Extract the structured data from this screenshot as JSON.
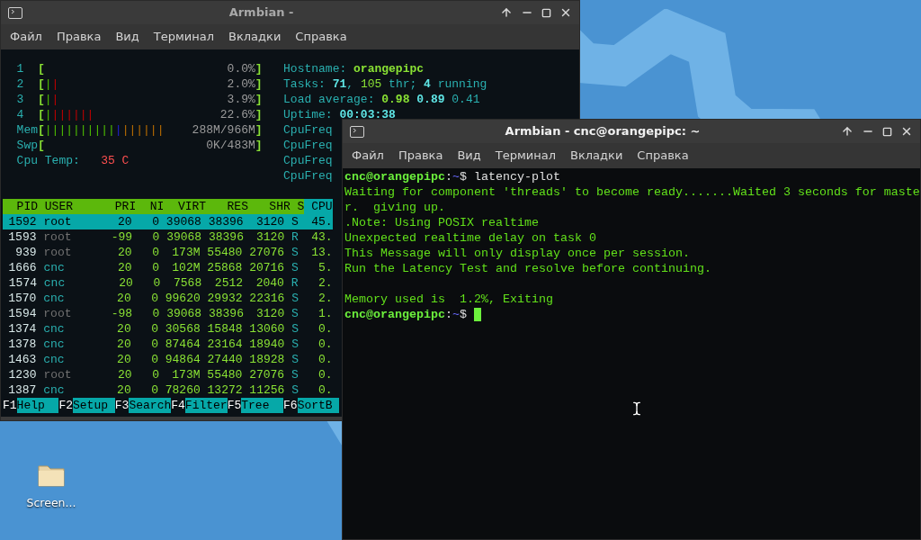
{
  "desktop": {
    "icons": [
      {
        "label": "Screen..."
      }
    ]
  },
  "windows": [
    {
      "kind": "htop",
      "title": "Armbian -",
      "active": false,
      "menu": [
        "Файл",
        "Правка",
        "Вид",
        "Терминал",
        "Вкладки",
        "Справка"
      ],
      "htop": {
        "meters": [
          {
            "label": "1",
            "brackets": [
              "[",
              "]"
            ],
            "value": "0.0%"
          },
          {
            "label": "2",
            "brackets": [
              "[",
              "]"
            ],
            "bars": [
              {
                "kind": "normal",
                "text": "|"
              },
              {
                "kind": "kernel",
                "text": "|"
              }
            ],
            "value": "2.0%"
          },
          {
            "label": "3",
            "brackets": [
              "[",
              "]"
            ],
            "bars": [
              {
                "kind": "normal",
                "text": "|"
              },
              {
                "kind": "kernel",
                "text": "|"
              }
            ],
            "value": "3.9%"
          },
          {
            "label": "4",
            "brackets": [
              "[",
              "]"
            ],
            "bars": [
              {
                "kind": "normal",
                "text": "|"
              },
              {
                "kind": "kernel",
                "text": "||||||"
              }
            ],
            "value": "22.6%"
          },
          {
            "label": "Mem",
            "brackets": [
              "[",
              "]"
            ],
            "bars": [
              {
                "kind": "normal",
                "text": "||||||||||"
              },
              {
                "kind": "buffers",
                "text": "|"
              },
              {
                "kind": "cache",
                "text": "||||||"
              }
            ],
            "value": "288M/966M"
          },
          {
            "label": "Swp",
            "brackets": [
              "[",
              "]"
            ],
            "value": "0K/483M"
          }
        ],
        "temp": {
          "label": "Cpu Temp:",
          "value": "35 C"
        },
        "info": [
          [
            {
              "kind": "label",
              "text": "Hostname: "
            },
            {
              "kind": "strong",
              "text": "orangepipc"
            }
          ],
          [
            {
              "kind": "label",
              "text": "Tasks: "
            },
            {
              "kind": "accent",
              "text": "71"
            },
            {
              "kind": "label",
              "text": ", "
            },
            {
              "kind": "green",
              "text": "105"
            },
            {
              "kind": "label",
              "text": " thr; "
            },
            {
              "kind": "accent",
              "text": "4"
            },
            {
              "kind": "label",
              "text": " running"
            }
          ],
          [
            {
              "kind": "label",
              "text": "Load average: "
            },
            {
              "kind": "strong",
              "text": "0.98"
            },
            {
              "kind": "accent",
              "text": " 0.89"
            },
            {
              "kind": "label",
              "text": " 0.41"
            }
          ],
          [
            {
              "kind": "label",
              "text": "Uptime: "
            },
            {
              "kind": "accent",
              "text": "00:03:38"
            }
          ],
          [
            {
              "kind": "label",
              "text": "CpuFreq"
            }
          ],
          [
            {
              "kind": "label",
              "text": "CpuFreq"
            }
          ],
          [
            {
              "kind": "label",
              "text": "CpuFreq"
            }
          ],
          [
            {
              "kind": "label",
              "text": "CpuFreq"
            }
          ]
        ],
        "columns": [
          {
            "label": "PID",
            "sorted": false
          },
          {
            "label": "USER",
            "sorted": false
          },
          {
            "label": "PRI",
            "sorted": false
          },
          {
            "label": "NI",
            "sorted": false
          },
          {
            "label": "VIRT",
            "sorted": false
          },
          {
            "label": "RES",
            "sorted": false
          },
          {
            "label": "SHR",
            "sorted": false
          },
          {
            "label": "S",
            "sorted": false
          },
          {
            "label": "CPU",
            "sorted": true
          }
        ],
        "rows": [
          {
            "selected": true,
            "user_dim": false,
            "cells": [
              "1592",
              "root",
              "20",
              "0",
              "39068",
              "38396",
              "3120",
              "S",
              "45."
            ]
          },
          {
            "selected": false,
            "user_dim": true,
            "cells": [
              "1593",
              "root",
              "-99",
              "0",
              "39068",
              "38396",
              "3120",
              "R",
              "43."
            ]
          },
          {
            "selected": false,
            "user_dim": true,
            "cells": [
              "939",
              "root",
              "20",
              "0",
              "173M",
              "55480",
              "27076",
              "S",
              "13."
            ]
          },
          {
            "selected": false,
            "user_dim": false,
            "cells": [
              "1666",
              "cnc",
              "20",
              "0",
              "102M",
              "25868",
              "20716",
              "S",
              "5."
            ]
          },
          {
            "selected": false,
            "user_dim": false,
            "cells": [
              "1574",
              "cnc",
              "20",
              "0",
              "7568",
              "2512",
              "2040",
              "R",
              "2."
            ]
          },
          {
            "selected": false,
            "user_dim": false,
            "cells": [
              "1570",
              "cnc",
              "20",
              "0",
              "99620",
              "29932",
              "22316",
              "S",
              "2."
            ]
          },
          {
            "selected": false,
            "user_dim": true,
            "cells": [
              "1594",
              "root",
              "-98",
              "0",
              "39068",
              "38396",
              "3120",
              "S",
              "1."
            ]
          },
          {
            "selected": false,
            "user_dim": false,
            "cells": [
              "1374",
              "cnc",
              "20",
              "0",
              "30568",
              "15848",
              "13060",
              "S",
              "0."
            ]
          },
          {
            "selected": false,
            "user_dim": false,
            "cells": [
              "1378",
              "cnc",
              "20",
              "0",
              "87464",
              "23164",
              "18940",
              "S",
              "0."
            ]
          },
          {
            "selected": false,
            "user_dim": false,
            "cells": [
              "1463",
              "cnc",
              "20",
              "0",
              "94864",
              "27440",
              "18928",
              "S",
              "0."
            ]
          },
          {
            "selected": false,
            "user_dim": true,
            "cells": [
              "1230",
              "root",
              "20",
              "0",
              "173M",
              "55480",
              "27076",
              "S",
              "0."
            ]
          },
          {
            "selected": false,
            "user_dim": false,
            "cells": [
              "1387",
              "cnc",
              "20",
              "0",
              "78260",
              "13272",
              "11256",
              "S",
              "0."
            ]
          }
        ],
        "keys": [
          {
            "key": "F1",
            "label": "Help"
          },
          {
            "key": "F2",
            "label": "Setup"
          },
          {
            "key": "F3",
            "label": "Search"
          },
          {
            "key": "F4",
            "label": "Filter"
          },
          {
            "key": "F5",
            "label": "Tree"
          },
          {
            "key": "F6",
            "label": "SortB"
          }
        ]
      }
    },
    {
      "kind": "shell",
      "title": "Armbian - cnc@orangepipc: ~",
      "active": true,
      "menu": [
        "Файл",
        "Правка",
        "Вид",
        "Терминал",
        "Вкладки",
        "Справка"
      ],
      "terminal": {
        "lines": [
          {
            "kind": "prompt",
            "user_host": "cnc@orangepipc",
            "separator": ":",
            "path": "~",
            "symbol": "$ ",
            "command": "latency-plot",
            "cursor": false
          },
          {
            "kind": "output",
            "text": "Waiting for component 'threads' to become ready.......Waited 3 seconds for maste"
          },
          {
            "kind": "output",
            "text": "r.  giving up."
          },
          {
            "kind": "output",
            "text": ".Note: Using POSIX realtime"
          },
          {
            "kind": "output",
            "text": "Unexpected realtime delay on task 0"
          },
          {
            "kind": "output",
            "text": "This Message will only display once per session."
          },
          {
            "kind": "output",
            "text": "Run the Latency Test and resolve before continuing."
          },
          {
            "kind": "blank"
          },
          {
            "kind": "output",
            "text": "Memory used is  1.2%, Exiting"
          },
          {
            "kind": "prompt",
            "user_host": "cnc@orangepipc",
            "separator": ":",
            "path": "~",
            "symbol": "$ ",
            "cursor": true
          }
        ]
      }
    }
  ]
}
